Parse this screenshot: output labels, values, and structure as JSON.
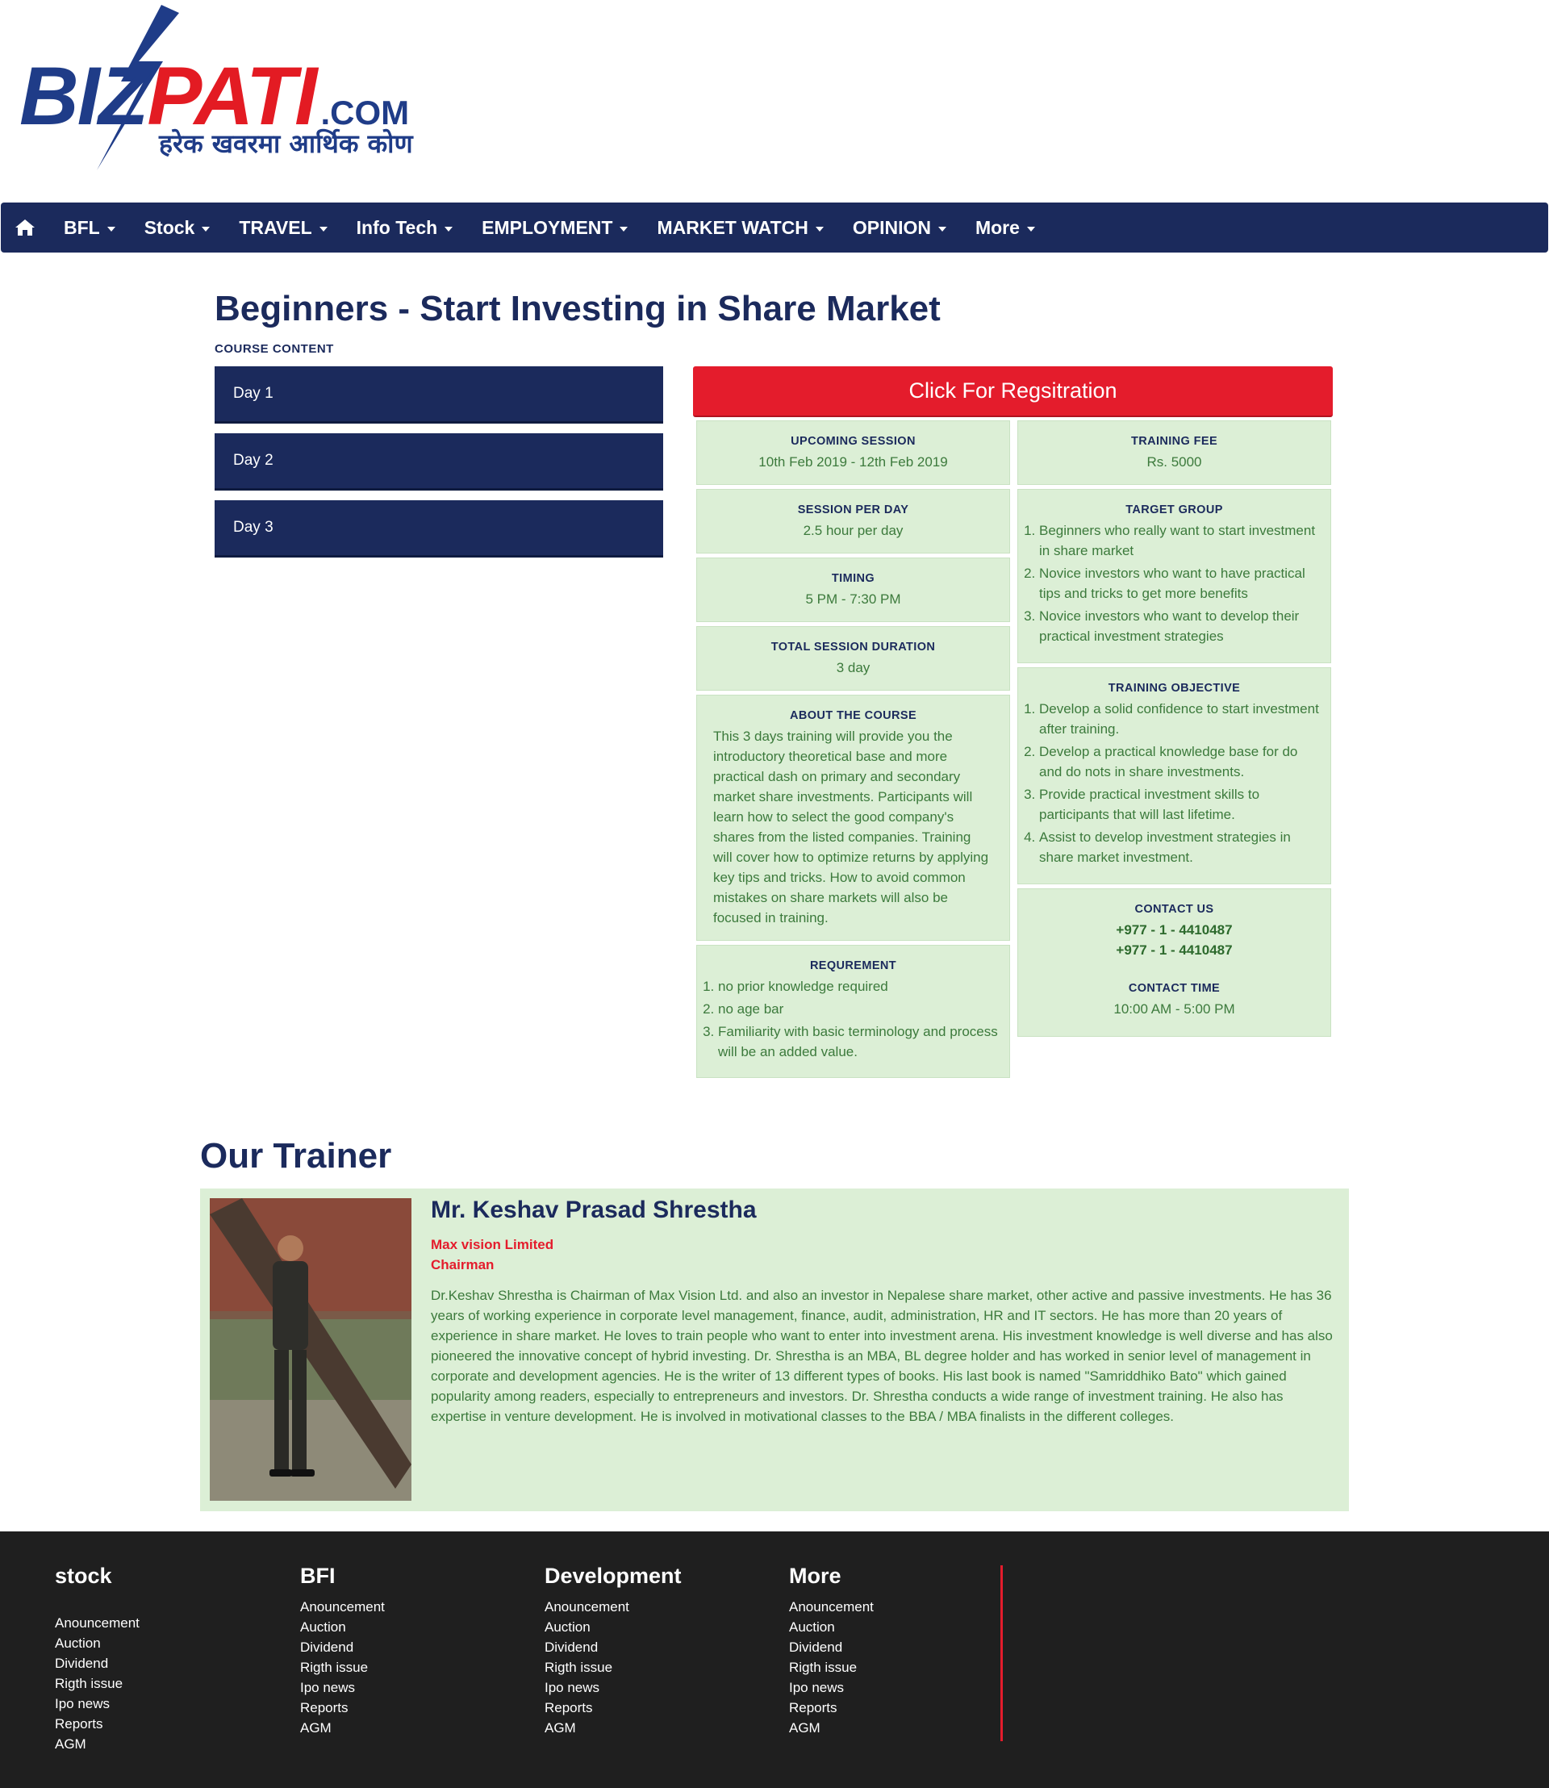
{
  "brand": {
    "name_biz": "BIZ",
    "name_pati": "PATI",
    "name_com": ".COM",
    "tagline": "हरेक खवरमा आर्थिक कोण",
    "blue": "#1f3c88",
    "red": "#e31b23"
  },
  "nav": {
    "home_icon": "home-icon",
    "items": [
      {
        "label": "BFL"
      },
      {
        "label": "Stock"
      },
      {
        "label": "TRAVEL"
      },
      {
        "label": "Info Tech"
      },
      {
        "label": "EMPLOYMENT"
      },
      {
        "label": "MARKET WATCH"
      },
      {
        "label": "OPINION"
      },
      {
        "label": "More"
      }
    ],
    "bg": "#1b2a5c"
  },
  "course": {
    "title": "Beginners - Start Investing in Share Market",
    "content_label": "COURSE CONTENT",
    "days": [
      "Day 1",
      "Day 2",
      "Day 3"
    ],
    "register_label": "Click For Regsitration",
    "upcoming": {
      "label": "UPCOMING SESSION",
      "value": "10th Feb 2019 - 12th Feb 2019"
    },
    "fee": {
      "label": "TRAINING FEE",
      "value": "Rs. 5000"
    },
    "session_per_day": {
      "label": "SESSION PER DAY",
      "value": "2.5 hour per day"
    },
    "timing": {
      "label": "TIMING",
      "value": "5 PM - 7:30 PM"
    },
    "duration": {
      "label": "TOTAL SESSION DURATION",
      "value": "3 day"
    },
    "about": {
      "label": "ABOUT THE COURSE",
      "text": "This 3 days training will provide you the introductory theoretical base and more practical dash on primary and secondary market share investments. Participants will learn how to select the good company's shares from the listed companies. Training will cover how to optimize returns by applying key tips and tricks. How to avoid common mistakes on share markets will also be focused in training."
    },
    "requirement": {
      "label": "REQUREMENT",
      "items": [
        "no prior knowledge required",
        "no age bar",
        "Familiarity with basic terminology and process will be an added value."
      ]
    },
    "target_group": {
      "label": "TARGET GROUP",
      "items": [
        "Beginners who really want to start investment in share market",
        "Novice investors who want to have practical tips and tricks to get more benefits",
        "Novice investors who want to develop their practical investment strategies"
      ]
    },
    "objective": {
      "label": "TRAINING OBJECTIVE",
      "items": [
        "Develop a solid confidence to start investment after training.",
        "Develop a practical knowledge base for do and do nots in share investments.",
        "Provide practical investment skills to participants that will last lifetime.",
        "Assist to develop investment strategies in share market investment."
      ]
    },
    "contact": {
      "label": "CONTACT US",
      "phone1": "+977 - 1 - 4410487",
      "phone2": "+977 - 1 - 4410487",
      "time_label": "CONTACT TIME",
      "time_value": "10:00 AM - 5:00 PM"
    }
  },
  "trainer": {
    "heading": "Our Trainer",
    "name": "Mr. Keshav Prasad Shrestha",
    "company": "Max vision Limited",
    "role": "Chairman",
    "bio": "Dr.Keshav Shrestha is Chairman of Max Vision Ltd. and also an investor in Nepalese share market, other active and passive investments. He has 36 years of working experience in corporate level management, finance, audit, administration, HR and IT sectors. He has more than 20 years of experience in share market. He loves to train people who want to enter into investment arena. His investment knowledge is well diverse and has also pioneered the innovative concept of hybrid investing. Dr. Shrestha is an MBA, BL degree holder and has worked in senior level of management in corporate and development agencies. He is the writer of 13 different types of books. His last book is named \"Samriddhiko Bato\" which gained popularity among readers, especially to entrepreneurs and investors. Dr. Shrestha conducts a wide range of investment training. He also has expertise in venture development. He is involved in motivational classes to the BBA / MBA finalists in the different colleges."
  },
  "footer": {
    "columns": [
      {
        "title": "stock",
        "links": [
          "Anouncement",
          "Auction",
          "Dividend",
          "Rigth issue",
          "Ipo news",
          "Reports",
          "AGM"
        ]
      },
      {
        "title": "BFI",
        "links": [
          "Anouncement",
          "Auction",
          "Dividend",
          "Rigth issue",
          "Ipo news",
          "Reports",
          "AGM"
        ]
      },
      {
        "title": "Development",
        "links": [
          "Anouncement",
          "Auction",
          "Dividend",
          "Rigth issue",
          "Ipo news",
          "Reports",
          "AGM"
        ]
      },
      {
        "title": "More",
        "links": [
          "Anouncement",
          "Auction",
          "Dividend",
          "Rigth issue",
          "Ipo news",
          "Reports",
          "AGM"
        ]
      }
    ]
  }
}
